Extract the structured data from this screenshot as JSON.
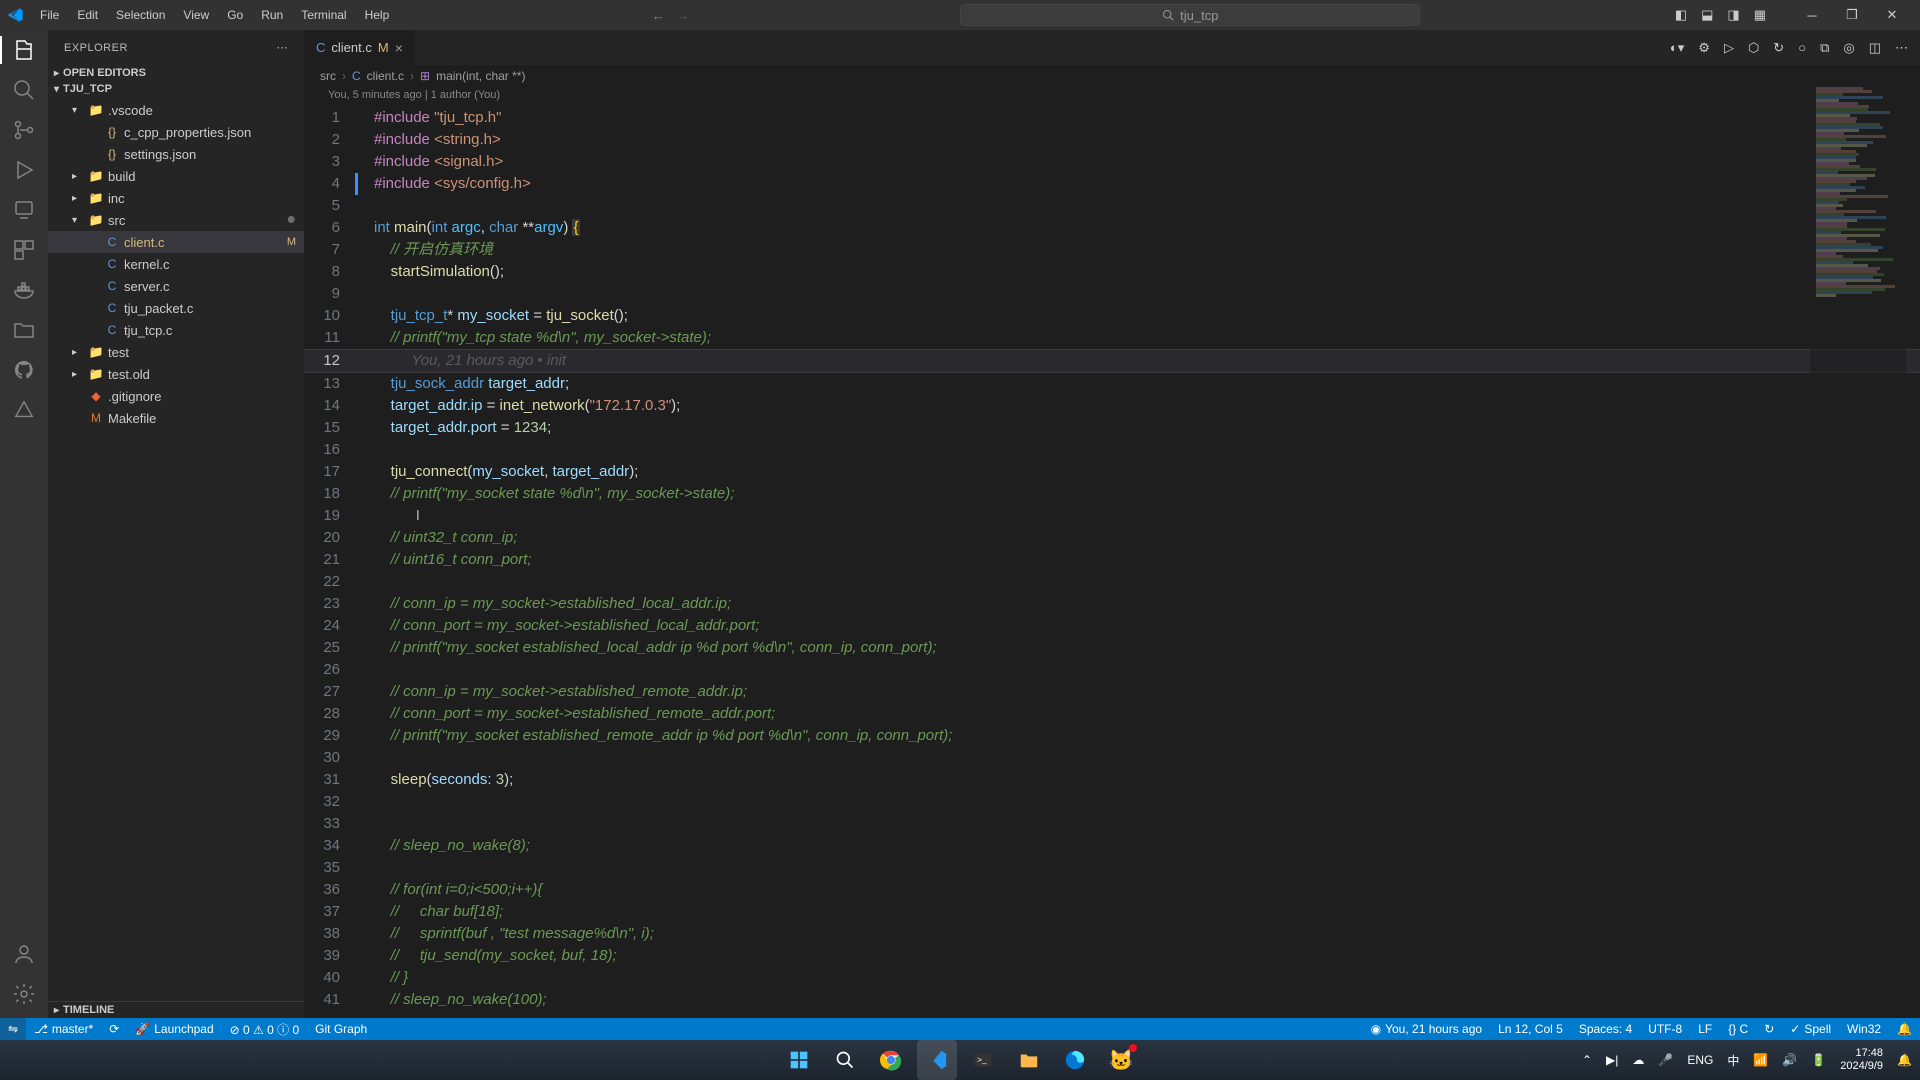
{
  "titlebar": {
    "menu": [
      "File",
      "Edit",
      "Selection",
      "View",
      "Go",
      "Run",
      "Terminal",
      "Help"
    ],
    "search_placeholder": "tju_tcp"
  },
  "sidebar": {
    "title": "EXPLORER",
    "sections": {
      "open_editors": "OPEN EDITORS",
      "workspace": "TJU_TCP",
      "timeline": "TIMELINE"
    },
    "tree": [
      {
        "icon": "folder",
        "label": ".vscode",
        "indent": 1,
        "chev": "▾",
        "class": "folder-yellow"
      },
      {
        "icon": "{}",
        "label": "c_cpp_properties.json",
        "indent": 2,
        "class": "file-json"
      },
      {
        "icon": "{}",
        "label": "settings.json",
        "indent": 2,
        "class": "file-json"
      },
      {
        "icon": "folder",
        "label": "build",
        "indent": 1,
        "chev": "▸",
        "class": "folder-yellow"
      },
      {
        "icon": "folder",
        "label": "inc",
        "indent": 1,
        "chev": "▸",
        "class": "folder-yellow"
      },
      {
        "icon": "folder",
        "label": "src",
        "indent": 1,
        "chev": "▾",
        "class": "folder-yellow",
        "src_dot": true
      },
      {
        "icon": "C",
        "label": "client.c",
        "indent": 2,
        "class": "file-c",
        "mod": "M",
        "active": true
      },
      {
        "icon": "C",
        "label": "kernel.c",
        "indent": 2,
        "class": "file-c"
      },
      {
        "icon": "C",
        "label": "server.c",
        "indent": 2,
        "class": "file-c"
      },
      {
        "icon": "C",
        "label": "tju_packet.c",
        "indent": 2,
        "class": "file-c"
      },
      {
        "icon": "C",
        "label": "tju_tcp.c",
        "indent": 2,
        "class": "file-c"
      },
      {
        "icon": "folder",
        "label": "test",
        "indent": 1,
        "chev": "▸",
        "class": "file-test"
      },
      {
        "icon": "folder",
        "label": "test.old",
        "indent": 1,
        "chev": "▸",
        "class": "folder-yellow"
      },
      {
        "icon": "◆",
        "label": ".gitignore",
        "indent": 1,
        "class": "file-git"
      },
      {
        "icon": "M",
        "label": "Makefile",
        "indent": 1,
        "class": "file-make"
      }
    ]
  },
  "editor": {
    "tab": {
      "name": "client.c",
      "mod": "M"
    },
    "breadcrumbs": [
      "src",
      "client.c",
      "main(int, char **)"
    ],
    "authorship": "You, 5 minutes ago | 1 author (You)",
    "blame_line12": "You, 21 hours ago • init",
    "current_line": 12,
    "lines": [
      {
        "n": 1,
        "html": "<span class='tk-keyword'>#include</span> <span class='tk-string'>\"tju_tcp.h\"</span>"
      },
      {
        "n": 2,
        "html": "<span class='tk-keyword'>#include</span> <span class='tk-string'>&lt;string.h&gt;</span>"
      },
      {
        "n": 3,
        "html": "<span class='tk-keyword'>#include</span> <span class='tk-string'>&lt;signal.h&gt;</span>"
      },
      {
        "n": 4,
        "html": "<span class='tk-keyword'>#include</span> <span class='tk-string'>&lt;sys/config.h&gt;</span>",
        "mod": true
      },
      {
        "n": 5,
        "html": ""
      },
      {
        "n": 6,
        "html": "<span class='tk-type'>int</span> <span class='tk-func'>main</span><span class='tk-punc'>(</span><span class='tk-type'>int</span> <span class='tk-param'>argc</span><span class='tk-punc'>,</span> <span class='tk-type'>char</span> <span class='tk-punc'>**</span><span class='tk-param'>argv</span><span class='tk-punc'>)</span> <span class='tk-brace tk-bracehl'>{</span>"
      },
      {
        "n": 7,
        "html": "    <span class='tk-comment'>// 开启仿真环境</span>"
      },
      {
        "n": 8,
        "html": "    <span class='tk-func'>startSimulation</span><span class='tk-punc'>();</span>"
      },
      {
        "n": 9,
        "html": ""
      },
      {
        "n": 10,
        "html": "    <span class='tk-type'>tju_tcp_t</span><span class='tk-punc'>*</span> <span class='tk-var'>my_socket</span> <span class='tk-punc'>=</span> <span class='tk-func'>tju_socket</span><span class='tk-punc'>();</span>"
      },
      {
        "n": 11,
        "html": "    <span class='tk-comment'>// printf(\"my_tcp state %d\\n\", my_socket-&gt;state);</span>"
      },
      {
        "n": 12,
        "html": "         <span class='tk-blame'>You, 21 hours ago • init</span>",
        "current": true
      },
      {
        "n": 13,
        "html": "    <span class='tk-type'>tju_sock_addr</span> <span class='tk-var'>target_addr</span><span class='tk-punc'>;</span>"
      },
      {
        "n": 14,
        "html": "    <span class='tk-var'>target_addr</span><span class='tk-punc'>.</span><span class='tk-field'>ip</span> <span class='tk-punc'>=</span> <span class='tk-func'>inet_network</span><span class='tk-punc'>(</span><span class='tk-string'>\"172.17.0.3\"</span><span class='tk-punc'>);</span>"
      },
      {
        "n": 15,
        "html": "    <span class='tk-var'>target_addr</span><span class='tk-punc'>.</span><span class='tk-field'>port</span> <span class='tk-punc'>=</span> <span class='tk-number'>1234</span><span class='tk-punc'>;</span>"
      },
      {
        "n": 16,
        "html": ""
      },
      {
        "n": 17,
        "html": "    <span class='tk-func'>tju_connect</span><span class='tk-punc'>(</span><span class='tk-var'>my_socket</span><span class='tk-punc'>,</span> <span class='tk-var'>target_addr</span><span class='tk-punc'>);</span>"
      },
      {
        "n": 18,
        "html": "    <span class='tk-comment'>// printf(\"my_socket state %d\\n\", my_socket-&gt;state);</span>"
      },
      {
        "n": 19,
        "html": "          <span class='cursor-mark'>I</span>"
      },
      {
        "n": 20,
        "html": "    <span class='tk-comment'>// uint32_t conn_ip;</span>"
      },
      {
        "n": 21,
        "html": "    <span class='tk-comment'>// uint16_t conn_port;</span>"
      },
      {
        "n": 22,
        "html": ""
      },
      {
        "n": 23,
        "html": "    <span class='tk-comment'>// conn_ip = my_socket-&gt;established_local_addr.ip;</span>"
      },
      {
        "n": 24,
        "html": "    <span class='tk-comment'>// conn_port = my_socket-&gt;established_local_addr.port;</span>"
      },
      {
        "n": 25,
        "html": "    <span class='tk-comment'>// printf(\"my_socket established_local_addr ip %d port %d\\n\", conn_ip, conn_port);</span>"
      },
      {
        "n": 26,
        "html": ""
      },
      {
        "n": 27,
        "html": "    <span class='tk-comment'>// conn_ip = my_socket-&gt;established_remote_addr.ip;</span>"
      },
      {
        "n": 28,
        "html": "    <span class='tk-comment'>// conn_port = my_socket-&gt;established_remote_addr.port;</span>"
      },
      {
        "n": 29,
        "html": "    <span class='tk-comment'>// printf(\"my_socket established_remote_addr ip %d port %d\\n\", conn_ip, conn_port);</span>"
      },
      {
        "n": 30,
        "html": ""
      },
      {
        "n": 31,
        "html": "    <span class='tk-func'>sleep</span><span class='tk-punc'>(</span><span class='tk-namedparam'>seconds:</span> <span class='tk-number'>3</span><span class='tk-punc'>);</span>"
      },
      {
        "n": 32,
        "html": ""
      },
      {
        "n": 33,
        "html": ""
      },
      {
        "n": 34,
        "html": "    <span class='tk-comment'>// sleep_no_wake(8);</span>"
      },
      {
        "n": 35,
        "html": ""
      },
      {
        "n": 36,
        "html": "    <span class='tk-comment'>// for(int i=0;i&lt;500;i++){</span>"
      },
      {
        "n": 37,
        "html": "    <span class='tk-comment'>//     char buf[18];</span>"
      },
      {
        "n": 38,
        "html": "    <span class='tk-comment'>//     sprintf(buf , \"test message%d\\n\", i);</span>"
      },
      {
        "n": 39,
        "html": "    <span class='tk-comment'>//     tju_send(my_socket, buf, 18);</span>"
      },
      {
        "n": 40,
        "html": "    <span class='tk-comment'>// }</span>"
      },
      {
        "n": 41,
        "html": "    <span class='tk-comment'>// sleep_no_wake(100);</span>"
      }
    ]
  },
  "statusbar": {
    "branch": "master*",
    "launchpad": "Launchpad",
    "problems": "0  0  0",
    "git_graph": "Git Graph",
    "blame": "You, 21 hours ago",
    "position": "Ln 12, Col 5",
    "spaces": "Spaces: 4",
    "encoding": "UTF-8",
    "eol": "LF",
    "lang": "{} C",
    "spell": "Spell",
    "win32": "Win32"
  },
  "taskbar": {
    "lang": "ENG",
    "ime": "中",
    "time": "17:48",
    "date": "2024/9/9"
  }
}
